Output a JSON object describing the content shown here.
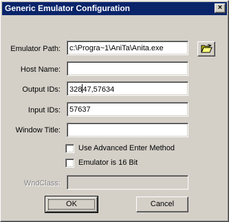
{
  "window": {
    "title": "Generic Emulator Configuration",
    "close_glyph": "×"
  },
  "fields": {
    "emulator_path": {
      "label": "Emulator Path:",
      "value": "c:\\Progra~1\\AniTa\\Anita.exe"
    },
    "host_name": {
      "label": "Host Name:",
      "value": ""
    },
    "output_ids": {
      "label": "Output IDs:",
      "value_before_caret": "328",
      "value_after_caret": "47,57634"
    },
    "input_ids": {
      "label": "Input IDs:",
      "value": "57637"
    },
    "window_title": {
      "label": "Window Title:",
      "value": ""
    },
    "wnd_class": {
      "label": "WndClass:",
      "value": ""
    }
  },
  "checkboxes": {
    "use_advanced_enter": {
      "label": "Use Advanced Enter Method",
      "checked": false
    },
    "emulator_16bit": {
      "label": "Emulator is 16 Bit",
      "checked": false
    }
  },
  "buttons": {
    "ok": "OK",
    "cancel": "Cancel",
    "browse_icon": "open-folder-icon"
  }
}
